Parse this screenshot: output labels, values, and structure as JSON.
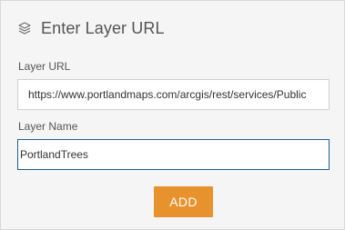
{
  "dialog": {
    "title": "Enter Layer URL",
    "title_icon": "layers-icon"
  },
  "layer_url": {
    "label": "Layer URL",
    "value": "https://www.portlandmaps.com/arcgis/rest/services/Public"
  },
  "layer_name": {
    "label": "Layer Name",
    "value": "PortlandTrees"
  },
  "actions": {
    "add_label": "ADD"
  },
  "colors": {
    "panel_background": "#f5f5f5",
    "accent_button": "#e8922e",
    "focused_border": "#1f5e94",
    "text": "#545454"
  }
}
